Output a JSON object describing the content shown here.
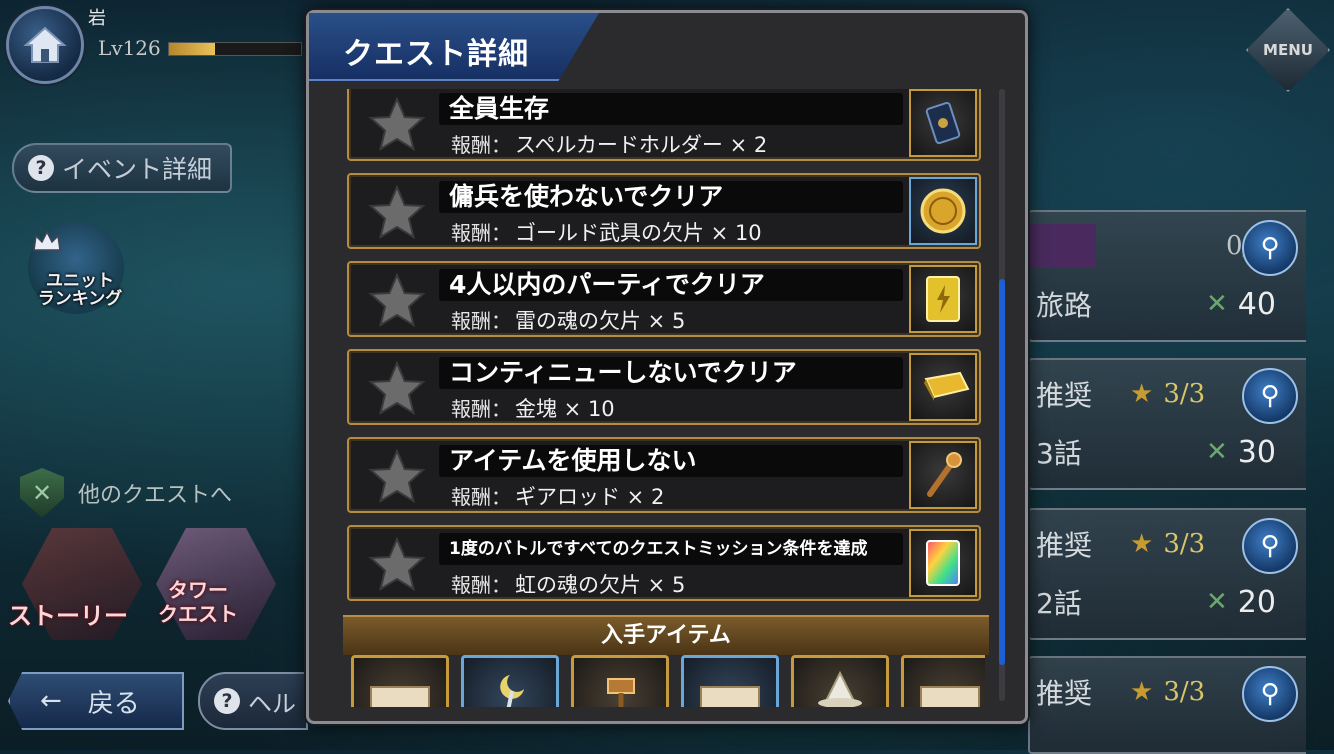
{
  "player": {
    "name": "岩",
    "level": "Lv126",
    "exp_fraction": 0.35
  },
  "left": {
    "event_detail": "イベント詳細",
    "ranking_label": "ユニット\nランキング",
    "other_quest": "他のクエストへ",
    "story_label": "ストーリー",
    "tower_label": "タワー\nクエスト",
    "back_label": "戻る",
    "help_label": "ヘル"
  },
  "right": {
    "menu_label": "MENU",
    "rows": [
      {
        "label": "",
        "count": "0/6",
        "title": "旅路",
        "ap": "40"
      },
      {
        "label": "推奨",
        "count": "3/3",
        "title": "3話",
        "ap": "30"
      },
      {
        "label": "推奨",
        "count": "3/3",
        "title": "2話",
        "ap": "20"
      },
      {
        "label": "推奨",
        "count": "3/3",
        "title": "",
        "ap": ""
      }
    ]
  },
  "dialog": {
    "title": "クエスト詳細",
    "reward_prefix": "報酬：",
    "missions": [
      {
        "title": "全員生存",
        "reward": "スペルカードホルダー × 2",
        "item_icon": "card-holder-icon"
      },
      {
        "title": "傭兵を使わないでクリア",
        "reward": "ゴールド武具の欠片 × 10",
        "item_icon": "gold-coin-icon"
      },
      {
        "title": "4人以内のパーティでクリア",
        "reward": "雷の魂の欠片 × 5",
        "item_icon": "thunder-soul-icon"
      },
      {
        "title": "コンティニューしないでクリア",
        "reward": "金塊 × 10",
        "item_icon": "gold-bar-icon"
      },
      {
        "title": "アイテムを使用しない",
        "reward": "ギアロッド × 2",
        "item_icon": "gear-rod-icon"
      },
      {
        "title": "1度のバトルですべてのクエストミッション条件を達成",
        "reward": "虹の魂の欠片 × 5",
        "item_icon": "rainbow-soul-icon"
      }
    ],
    "acquired_header": "入手アイテム",
    "acquired_items": [
      "scroll-icon",
      "crescent-staff-icon",
      "hammer-icon",
      "scroll-icon",
      "wizard-hat-icon",
      "scroll-icon"
    ]
  },
  "colors": {
    "gold_frame": "#b48d42",
    "blue_frame": "#6aa6d6",
    "scroll_thumb": "#1e5fd6",
    "header_blue": "#1e3f78"
  }
}
